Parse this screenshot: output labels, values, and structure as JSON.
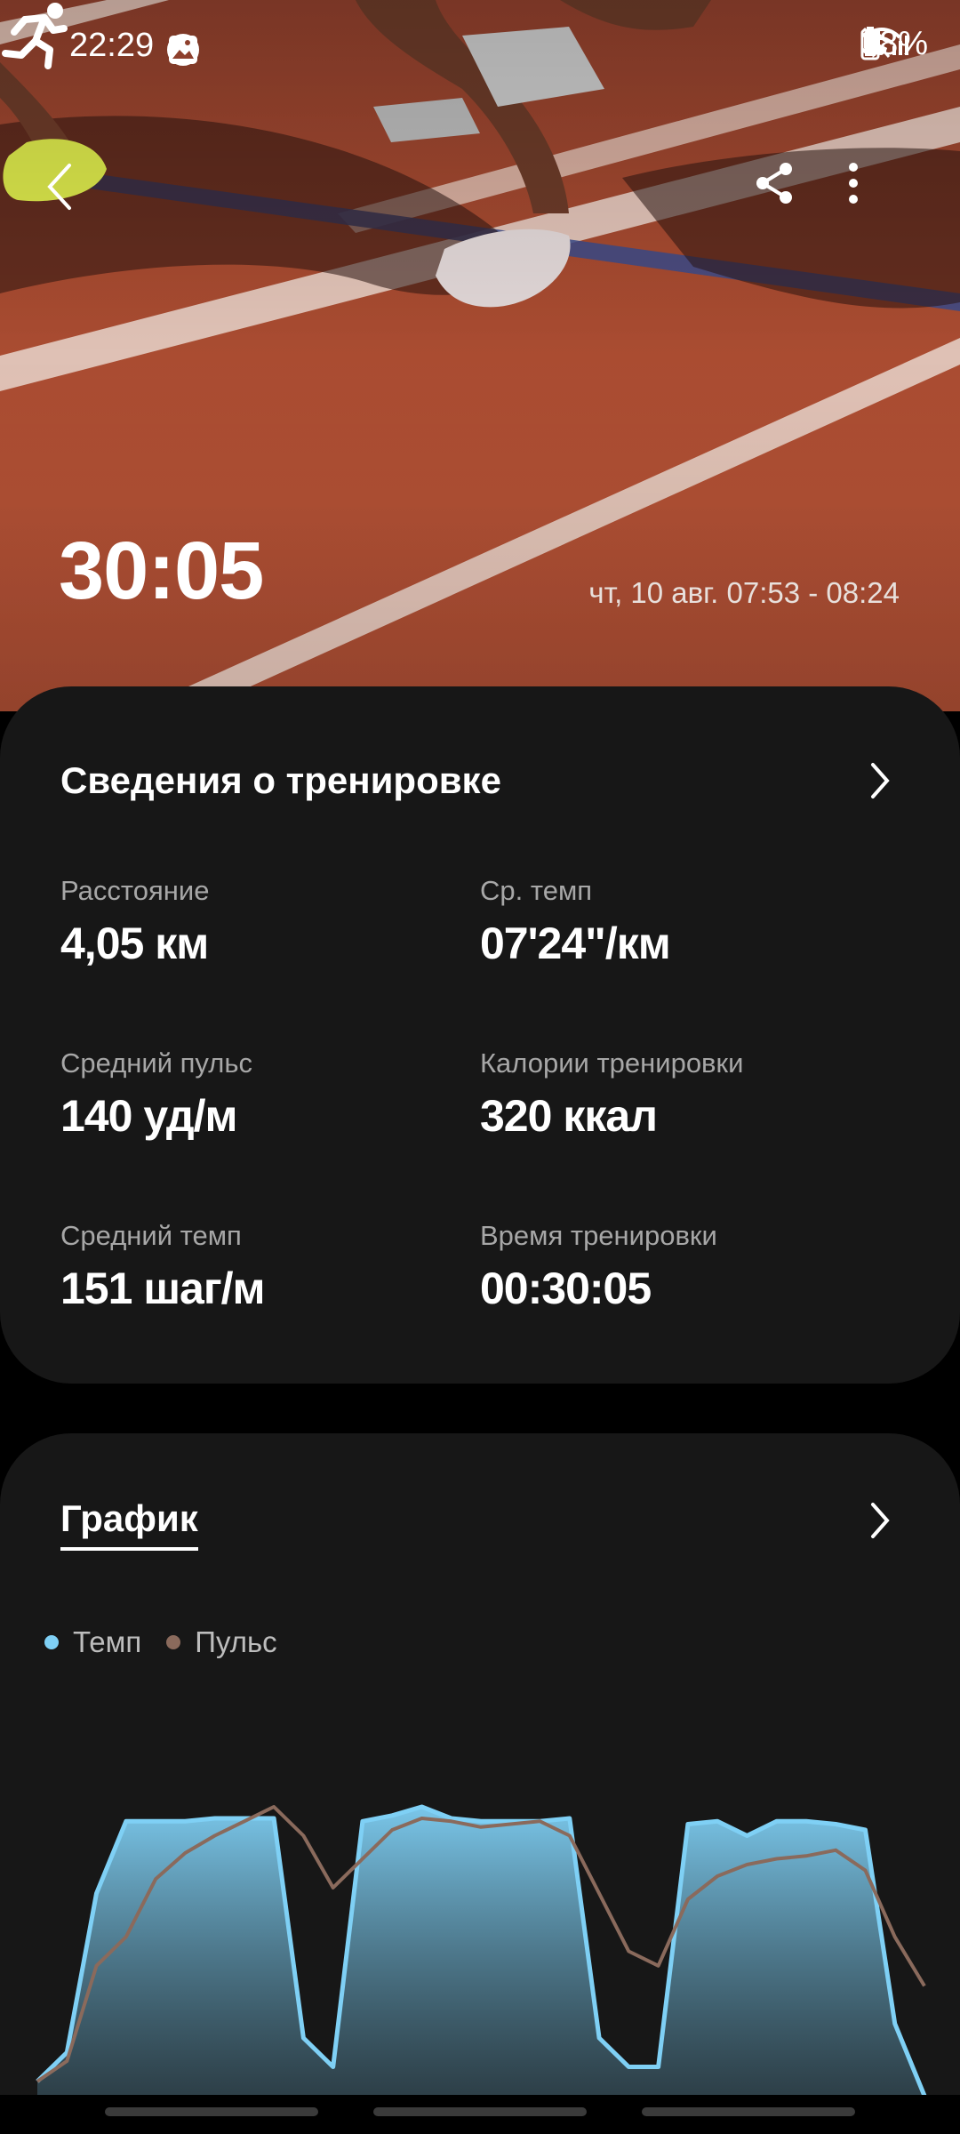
{
  "status_bar": {
    "time": "22:29",
    "battery": "38%",
    "left_icons": [
      "check-circle-icon",
      "image-icon"
    ],
    "right_icons": [
      "bluetooth-icon",
      "mute-icon",
      "wifi-icon",
      "volte1-icon",
      "signal-icon",
      "volte2-icon",
      "signal-icon",
      "battery-icon"
    ]
  },
  "app_bar": {
    "icons": [
      "back-icon",
      "share-icon",
      "more-icon"
    ]
  },
  "hero": {
    "activity_icon": "running-icon",
    "duration": "30:05",
    "date_range": "чт, 10 авг. 07:53 - 08:24"
  },
  "summary": {
    "title": "Сведения о тренировке",
    "stats": [
      {
        "label": "Расстояние",
        "value": "4,05",
        "unit": "км"
      },
      {
        "label": "Ср. темп",
        "value": "07'24\"",
        "unit": "/км"
      },
      {
        "label": "Средний пульс",
        "value": "140",
        "unit": "уд/м"
      },
      {
        "label": "Калории тренировки",
        "value": "320",
        "unit": "ккал"
      },
      {
        "label": "Средний темп",
        "value": "151",
        "unit": "шаг/м"
      },
      {
        "label": "Время тренировки",
        "value": "00:30:05",
        "unit": ""
      }
    ]
  },
  "chart_card": {
    "tab_label": "График",
    "legend": [
      {
        "label": "Темп",
        "color": "#7fd0f5"
      },
      {
        "label": "Пульс",
        "color": "#8a6a5c"
      }
    ]
  },
  "chart_data": {
    "type": "area",
    "title": "",
    "xlabel": "",
    "ylabel": "",
    "grid": false,
    "legend_placement": "top-left",
    "x": [
      0,
      1,
      2,
      3,
      4,
      5,
      6,
      7,
      8,
      9,
      10,
      11,
      12,
      13,
      14,
      15,
      16,
      17,
      18,
      19,
      20,
      21,
      22,
      23,
      24,
      25,
      26,
      27,
      28,
      29,
      30
    ],
    "series": [
      {
        "name": "Темп",
        "color": "#7fd0f5",
        "values": [
          0.05,
          0.15,
          0.7,
          0.95,
          0.95,
          0.95,
          0.96,
          0.96,
          0.96,
          0.2,
          0.1,
          0.95,
          0.97,
          1.0,
          0.96,
          0.95,
          0.95,
          0.95,
          0.96,
          0.2,
          0.1,
          0.1,
          0.94,
          0.95,
          0.9,
          0.95,
          0.95,
          0.94,
          0.92,
          0.25,
          0.0
        ]
      },
      {
        "name": "Пульс",
        "color": "#8a6a5c",
        "values": [
          0.05,
          0.12,
          0.45,
          0.55,
          0.75,
          0.84,
          0.9,
          0.95,
          1.0,
          0.9,
          0.72,
          0.82,
          0.92,
          0.96,
          0.95,
          0.93,
          0.94,
          0.95,
          0.9,
          0.7,
          0.5,
          0.45,
          0.68,
          0.76,
          0.8,
          0.82,
          0.83,
          0.85,
          0.78,
          0.55,
          0.38
        ]
      }
    ]
  },
  "colors": {
    "card_bg": "#171717",
    "track": "#a4492f",
    "accent_temp": "#7fd0f5",
    "accent_pulse": "#8a6a5c"
  }
}
